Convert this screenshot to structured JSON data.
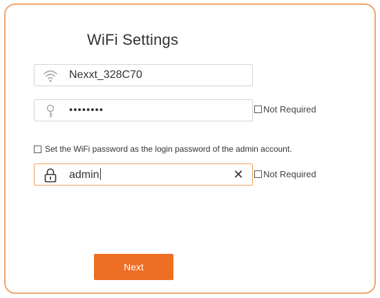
{
  "title": "WiFi Settings",
  "wifi_name": {
    "value": "Nexxt_328C70",
    "icon": "wifi-icon"
  },
  "wifi_password": {
    "value": "••••••••",
    "icon": "key-icon",
    "not_required_label": "Not Required",
    "not_required_checked": false
  },
  "use_for_admin": {
    "label": "Set the WiFi password as the login password of the admin account.",
    "checked": false
  },
  "admin_password": {
    "value": "admin",
    "icon": "lock-icon",
    "clear_icon": "close-icon",
    "not_required_label": "Not Required",
    "not_required_checked": false
  },
  "next_label": "Next",
  "colors": {
    "accent": "#ee6e24",
    "border": "#f0a56b"
  }
}
